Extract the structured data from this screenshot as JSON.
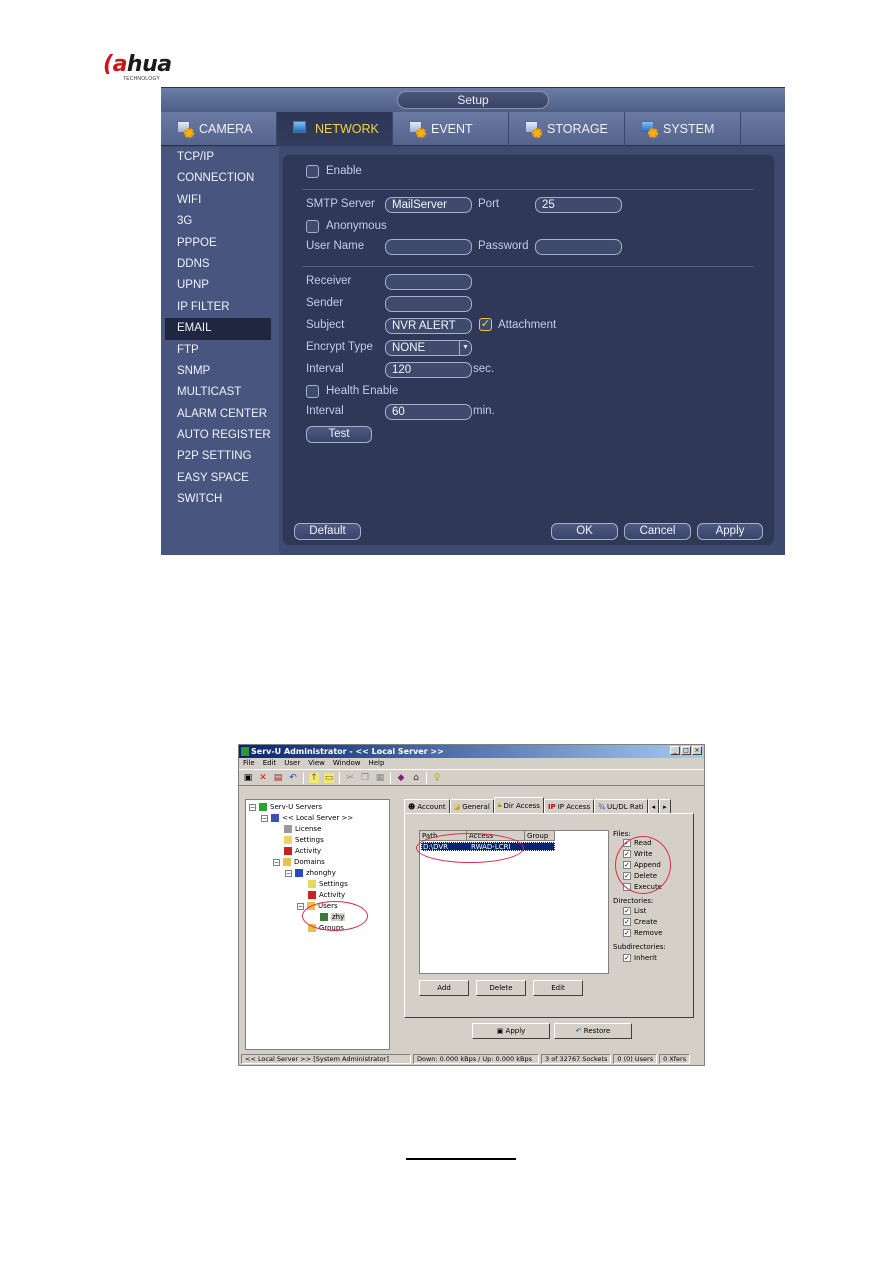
{
  "logo": {
    "brand_prefix": "a",
    "brand_rest": "hua",
    "brand_lead": "(",
    "tagline": "TECHNOLOGY"
  },
  "nvr": {
    "title": "Setup",
    "tabs": [
      {
        "label": "CAMERA",
        "icon": "camera-gear-icon",
        "active": false
      },
      {
        "label": "NETWORK",
        "icon": "network-icon",
        "active": true
      },
      {
        "label": "EVENT",
        "icon": "event-gear-icon",
        "active": false
      },
      {
        "label": "STORAGE",
        "icon": "storage-gear-icon",
        "active": false
      },
      {
        "label": "SYSTEM",
        "icon": "system-gear-icon",
        "active": false
      }
    ],
    "sidebar": [
      "TCP/IP",
      "CONNECTION",
      "WIFI",
      "3G",
      "PPPOE",
      "DDNS",
      "UPNP",
      "IP FILTER",
      "EMAIL",
      "FTP",
      "SNMP",
      "MULTICAST",
      "ALARM CENTER",
      "AUTO REGISTER",
      "P2P SETTING",
      "EASY SPACE",
      "SWITCH"
    ],
    "sidebar_active": "EMAIL",
    "form": {
      "enable_label": "Enable",
      "enable_checked": false,
      "smtp_label": "SMTP Server",
      "smtp_value": "MailServer",
      "port_label": "Port",
      "port_value": "25",
      "anonymous_label": "Anonymous",
      "anonymous_checked": false,
      "username_label": "User Name",
      "username_value": "",
      "password_label": "Password",
      "password_value": "",
      "receiver_label": "Receiver",
      "receiver_value": "",
      "sender_label": "Sender",
      "sender_value": "",
      "subject_label": "Subject",
      "subject_value": "NVR ALERT",
      "attachment_label": "Attachment",
      "attachment_checked": true,
      "encrypt_label": "Encrypt Type",
      "encrypt_value": "NONE",
      "interval_label": "Interval",
      "interval_value": "120",
      "interval_unit": "sec.",
      "health_label": "Health Enable",
      "health_checked": false,
      "health_interval_label": "Interval",
      "health_interval_value": "60",
      "health_interval_unit": "min.",
      "test_label": "Test"
    },
    "buttons": {
      "default": "Default",
      "ok": "OK",
      "cancel": "Cancel",
      "apply": "Apply"
    }
  },
  "servu": {
    "title": "Serv-U Administrator - << Local Server >>",
    "menu": [
      "File",
      "Edit",
      "User",
      "View",
      "Window",
      "Help"
    ],
    "tree": {
      "root": "Serv-U Servers",
      "server": "<< Local Server >>",
      "license": "License",
      "settings": "Settings",
      "activity": "Activity",
      "domains": "Domains",
      "domain": "zhonghy",
      "domain_settings": "Settings",
      "domain_activity": "Activity",
      "users": "Users",
      "user": "zhy",
      "groups": "Groups"
    },
    "tabs": [
      "Account",
      "General",
      "Dir Access",
      "IP Access",
      "UL/DL Rati"
    ],
    "active_tab": "Dir Access",
    "list": {
      "headers": [
        "Path",
        "Access",
        "Group"
      ],
      "rows": [
        {
          "path": "D:\\DVR",
          "access": "RWAD-LCRI",
          "group": ""
        }
      ]
    },
    "files_label": "Files:",
    "files": [
      {
        "label": "Read",
        "checked": true
      },
      {
        "label": "Write",
        "checked": true
      },
      {
        "label": "Append",
        "checked": true
      },
      {
        "label": "Delete",
        "checked": true
      },
      {
        "label": "Execute",
        "checked": false
      }
    ],
    "dirs_label": "Directories:",
    "dirs": [
      {
        "label": "List",
        "checked": true
      },
      {
        "label": "Create",
        "checked": true
      },
      {
        "label": "Remove",
        "checked": true
      }
    ],
    "subdirs_label": "Subdirectories:",
    "subdirs": [
      {
        "label": "Inherit",
        "checked": true
      }
    ],
    "buttons": {
      "add": "Add",
      "delete": "Delete",
      "edit": "Edit",
      "apply": "Apply",
      "restore": "Restore"
    },
    "status": {
      "server": "<< Local Server >>   [System Administrator]",
      "speed": "Down: 0.000 kBps / Up: 0.000 kBps",
      "sockets": "3 of 32767 Sockets",
      "users": "0 (0) Users",
      "xfers": "0 Xfers"
    }
  }
}
